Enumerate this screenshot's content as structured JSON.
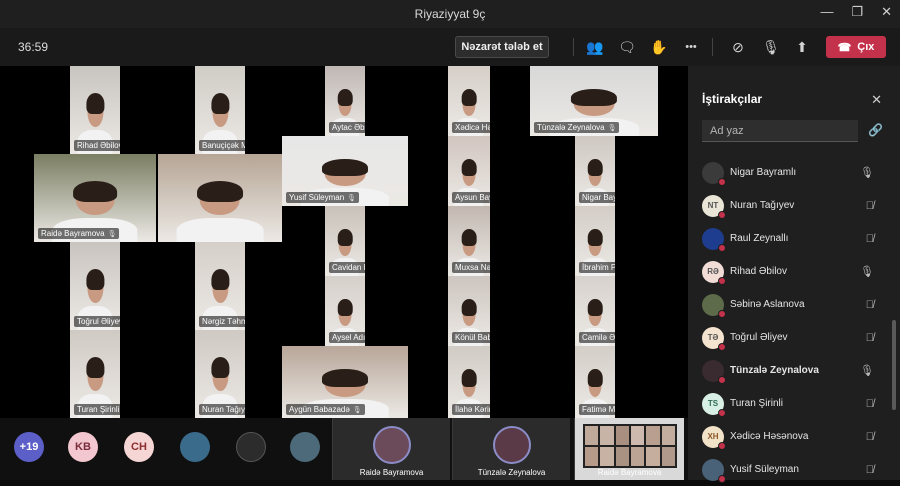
{
  "window": {
    "title": "Riyaziyyat 9ç",
    "min_icon": "—",
    "max_icon": "❐",
    "close_icon": "✕"
  },
  "toolbar": {
    "timer": "36:59",
    "control_label": "Nəzarət tələb et",
    "leave_label": "Çıx",
    "icons": {
      "people": "👥",
      "chat": "🗨",
      "raise_hand": "✋",
      "more": "•••",
      "camera_off": "⊘",
      "mic_off": "🎙",
      "share": "⬆",
      "leave": "☎"
    }
  },
  "stage": {
    "tiles": [
      {
        "name": "Rihad Əbilov"
      },
      {
        "name": "Banuçiçək Məmmədli"
      },
      {
        "name": "Aytac Əbilova"
      },
      {
        "name": "Xədicə Həsənova"
      },
      {
        "name": "Tünzalə Zeynalova"
      },
      {
        "name": "Raidə Bayramova"
      },
      {
        "name": ""
      },
      {
        "name": "Yusif Süleyman"
      },
      {
        "name": "Aysun Bayramova"
      },
      {
        "name": "Nigar Bayramlı"
      },
      {
        "name": "Cavidan Həsənov"
      },
      {
        "name": "Muxsa Nəsirli"
      },
      {
        "name": "İbrahim Paşazadə"
      },
      {
        "name": "Toğrul Əliyev"
      },
      {
        "name": "Nərgiz Təhməzli"
      },
      {
        "name": "Aysel Adıgözəlova"
      },
      {
        "name": "Könül Babayeva"
      },
      {
        "name": "Camilə Ələkbərova"
      },
      {
        "name": "Turan Şirinli"
      },
      {
        "name": "Nuran Tağıyev"
      },
      {
        "name": "Aygün Babazadə"
      },
      {
        "name": "İlahə Kərimova"
      },
      {
        "name": "Fatimə Məmmədova"
      }
    ]
  },
  "bottom": {
    "overflow_count": "+19",
    "avatars": [
      {
        "initials": "KB"
      },
      {
        "initials": "CH"
      }
    ],
    "spotlights": [
      {
        "name": "Raidə Bayramova"
      },
      {
        "name": "Tünzalə Zeynalova"
      }
    ],
    "screen_share_label": "Raidə Bayramova"
  },
  "panel": {
    "title": "İştirakçılar",
    "close_icon": "✕",
    "search_placeholder": "Ad yaz",
    "link_icon": "🔗",
    "participants": [
      {
        "name": "Nigar Bayramlı",
        "initials": "",
        "mic": "🎙",
        "bold": false
      },
      {
        "name": "Nuran Tağıyev",
        "initials": "NT",
        "mic": "🎙̸",
        "bold": false
      },
      {
        "name": "Raul Zeynallı",
        "initials": "",
        "mic": "🎙̸",
        "bold": false
      },
      {
        "name": "Rihad Əbilov",
        "initials": "RƏ",
        "mic": "🎙",
        "bold": false
      },
      {
        "name": "Səbinə Aslanova",
        "initials": "",
        "mic": "🎙̸",
        "bold": false
      },
      {
        "name": "Toğrul Əliyev",
        "initials": "TƏ",
        "mic": "🎙̸",
        "bold": false
      },
      {
        "name": "Tünzalə Zeynalova",
        "initials": "",
        "mic": "🎙",
        "bold": true
      },
      {
        "name": "Turan Şirinli",
        "initials": "TS",
        "mic": "🎙̸",
        "bold": false
      },
      {
        "name": "Xədicə Həsənova",
        "initials": "XH",
        "mic": "🎙̸",
        "bold": false
      },
      {
        "name": "Yusif Süleyman",
        "initials": "",
        "mic": "🎙̸",
        "bold": false
      }
    ]
  }
}
